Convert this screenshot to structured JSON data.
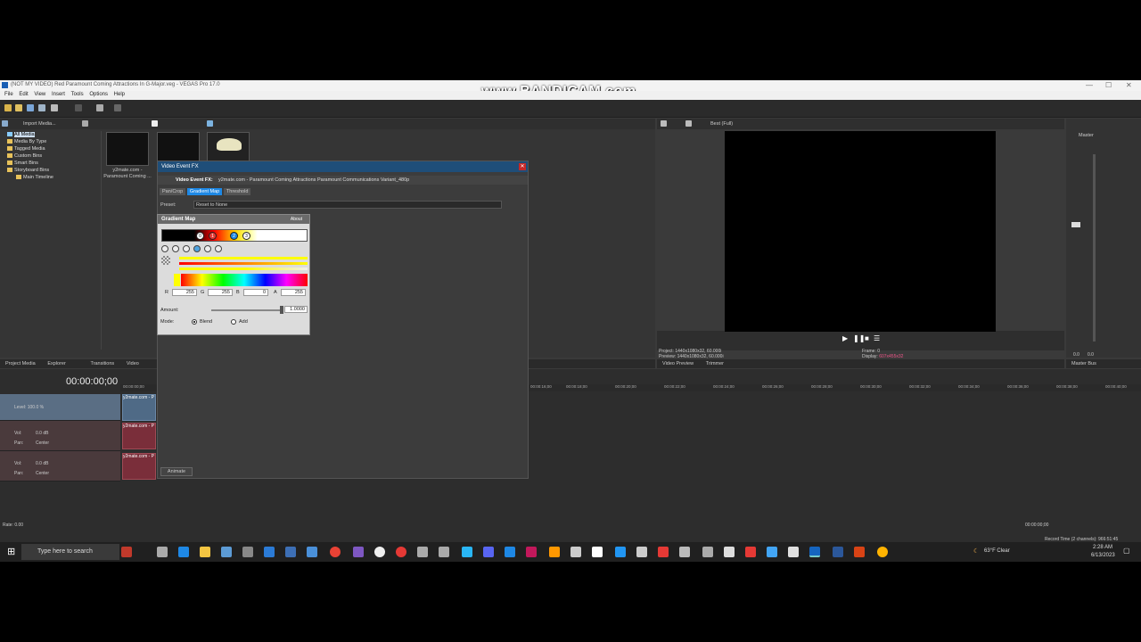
{
  "window": {
    "title": "(NOT MY VIDEO) Red Paramount Coming Attractions In G-Major.veg - VEGAS Pro 17.0",
    "watermark": "www.BANDICAM.com"
  },
  "menu": [
    "File",
    "Edit",
    "View",
    "Insert",
    "Tools",
    "Options",
    "Help"
  ],
  "media_panel": {
    "import_label": "Import Media...",
    "tree": [
      {
        "label": "All Media",
        "selected": true
      },
      {
        "label": "Media By Type"
      },
      {
        "label": "Tagged Media"
      },
      {
        "label": "Custom Bins"
      },
      {
        "label": "Smart Bins"
      },
      {
        "label": "Storyboard Bins"
      },
      {
        "label": "Main Timeline"
      }
    ],
    "thumb_caption_1": "y2mate.com -",
    "thumb_caption_2": "Paramount Coming ...",
    "tabs": [
      "Project Media",
      "Explorer",
      "Transitions",
      "Video"
    ]
  },
  "fx_dialog": {
    "title": "Video Event FX",
    "event_label": "Video Event FX:",
    "event_name": "y2mate.com - Paramount Coming Attractions Paramount Communications Variant_480p",
    "chain": [
      "Pan/Crop",
      "Gradient Map",
      "Threshold"
    ],
    "preset_label": "Preset:",
    "preset_value": "Reset to None",
    "plugin_title": "Gradient Map",
    "about": "About",
    "knob_labels": [
      "0",
      "1",
      "2",
      "3"
    ],
    "r_label": "R",
    "g_label": "G",
    "b_label": "B",
    "a_label": "A",
    "r_value": "255",
    "g_value": "255",
    "b_value": "0",
    "a_value": "255",
    "amount_label": "Amount:",
    "amount_value": "1.0000",
    "mode_label": "Mode:",
    "mode_blend": "Blend",
    "mode_add": "Add",
    "animate": "Animate"
  },
  "preview": {
    "quality": "Best (Full)",
    "project_label": "Project:",
    "project_value": "1440x1080x32, 60.000i",
    "preview_label": "Preview:",
    "preview_value": "1440x1080x32, 60.000i",
    "frame_label": "Frame:",
    "frame_value": "0",
    "display_label": "Display:",
    "display_value": "607x455x32",
    "tabs": [
      "Video Preview",
      "Trimmer"
    ]
  },
  "master": {
    "label": "Master",
    "tab": "Master Bus",
    "scale": [
      "3",
      "6",
      "9",
      "12",
      "15",
      "18",
      "21",
      "24",
      "27",
      "30",
      "33",
      "36",
      "39",
      "42",
      "45",
      "48",
      "51",
      "54",
      "57"
    ],
    "bottom_left": "0.0",
    "bottom_right": "0.0"
  },
  "timeline": {
    "timecode": "00:00:00;00",
    "track1_level": "Level: 100.0 %",
    "audio_vol_label": "Vol:",
    "audio_vol_value": "0.0 dB",
    "audio_pan_label": "Pan:",
    "audio_pan_value": "Center",
    "clip_label": "y2mate.com - P",
    "clip_badge": "1.500",
    "ruler": [
      "00:00:00;00",
      "00:00:16;00",
      "00:00:18;00",
      "00:00:20;00",
      "00:00:22;00",
      "00:00:24;00",
      "00:00:26;00",
      "00:00:28;00",
      "00:00:30;00",
      "00:00:32;00",
      "00:00:34;00",
      "00:00:36;00",
      "00:00:38;00",
      "00:00:40;00"
    ],
    "rate": "Rate: 0.00",
    "end_time": "00:00:00;00",
    "record_time": "Record Time (2 channels): 966:51:45"
  },
  "taskbar": {
    "search_placeholder": "Type here to search",
    "weather": "63°F  Clear",
    "time": "2:28 AM",
    "date": "6/13/2023"
  }
}
